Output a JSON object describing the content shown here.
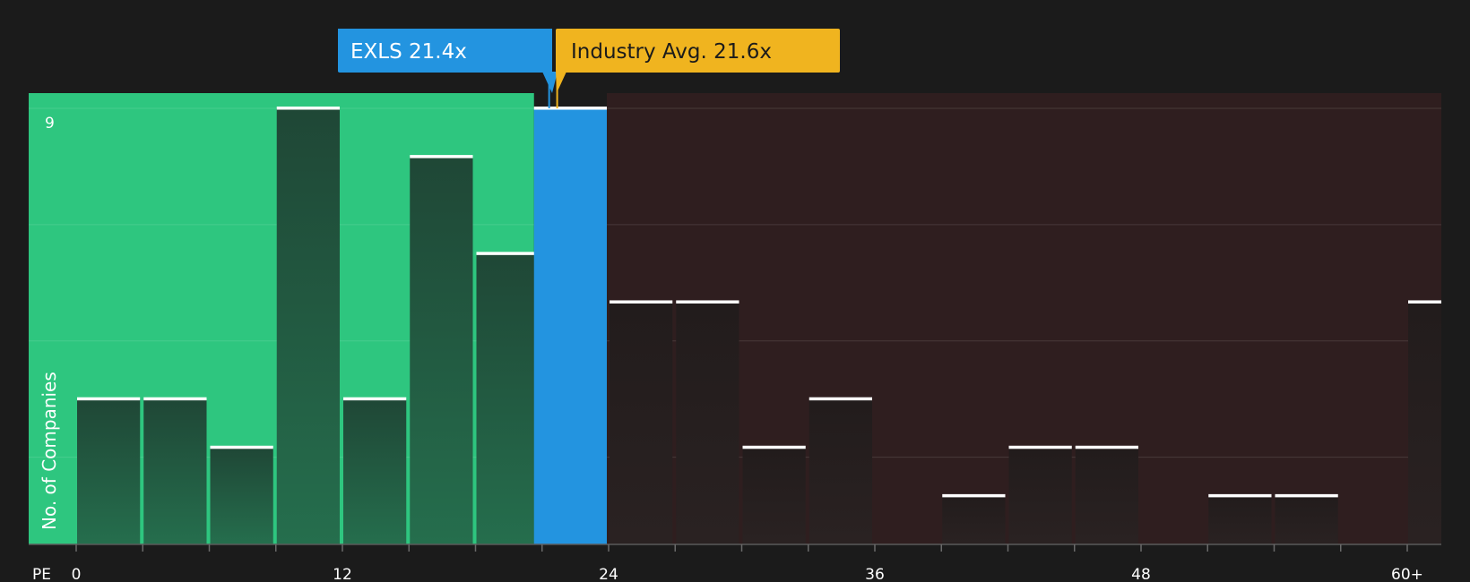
{
  "chart_data": {
    "type": "bar",
    "xlabel": "PE",
    "ylabel": "No. of Companies",
    "y_top_label": "9",
    "ylim": [
      0,
      9
    ],
    "x_ticks": [
      "0",
      "12",
      "24",
      "36",
      "48",
      "60+"
    ],
    "bins": [
      {
        "start": 0,
        "end": 3,
        "count": 3
      },
      {
        "start": 3,
        "end": 6,
        "count": 3
      },
      {
        "start": 6,
        "end": 9,
        "count": 2
      },
      {
        "start": 9,
        "end": 12,
        "count": 9
      },
      {
        "start": 12,
        "end": 15,
        "count": 3
      },
      {
        "start": 15,
        "end": 18,
        "count": 8
      },
      {
        "start": 18,
        "end": 21,
        "count": 6
      },
      {
        "start": 21,
        "end": 24,
        "count": 9,
        "highlight": true
      },
      {
        "start": 24,
        "end": 27,
        "count": 5
      },
      {
        "start": 27,
        "end": 30,
        "count": 5
      },
      {
        "start": 30,
        "end": 33,
        "count": 2
      },
      {
        "start": 33,
        "end": 36,
        "count": 3
      },
      {
        "start": 36,
        "end": 39,
        "count": 0
      },
      {
        "start": 39,
        "end": 42,
        "count": 1
      },
      {
        "start": 42,
        "end": 45,
        "count": 2
      },
      {
        "start": 45,
        "end": 48,
        "count": 2
      },
      {
        "start": 48,
        "end": 51,
        "count": 0
      },
      {
        "start": 51,
        "end": 54,
        "count": 1
      },
      {
        "start": 54,
        "end": 57,
        "count": 1
      },
      {
        "start": 57,
        "end": 60,
        "count": 0
      },
      {
        "start": 60,
        "end": 63,
        "count": 5
      }
    ],
    "markers": [
      {
        "name": "EXLS",
        "label": "EXLS 21.4x",
        "value": 21.4,
        "color": "#2394e0"
      },
      {
        "name": "Industry Avg.",
        "label": "Industry Avg. 21.6x",
        "value": 21.6,
        "color": "#f0b41f"
      }
    ],
    "colors": {
      "background": "#1b1b1b",
      "undervalued_region": "#2ec67f",
      "overvalued_region": "#2f1e1f",
      "highlight_bar": "#2394e0"
    }
  }
}
